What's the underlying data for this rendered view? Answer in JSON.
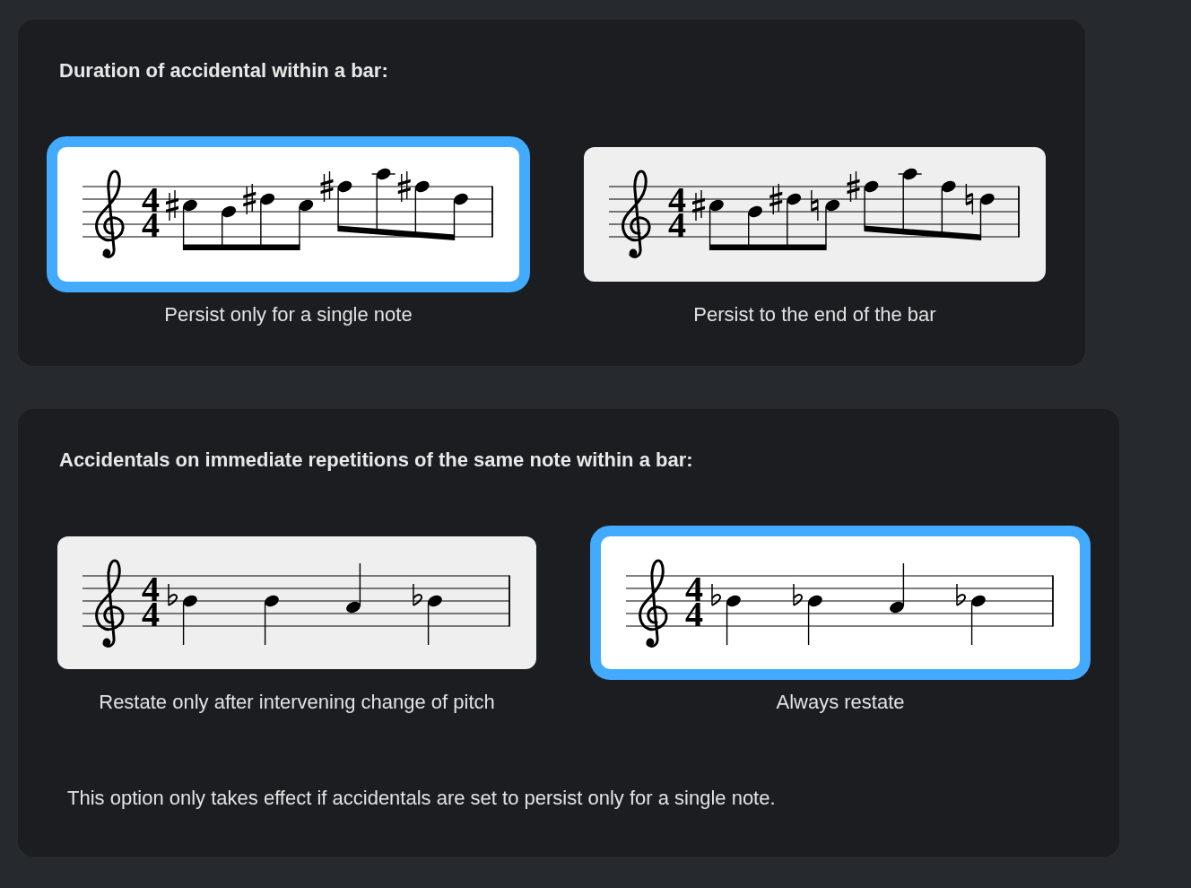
{
  "sections": [
    {
      "title": "Duration of accidental within a bar:",
      "options": [
        {
          "label": "Persist only for a single note",
          "selected": true,
          "score": {
            "time_signature": {
              "upper": "4",
              "lower": "4"
            },
            "notes": [
              {
                "kind": "sharp"
              },
              {
                "kind": "plain"
              },
              {
                "kind": "sharp"
              },
              {
                "kind": "plain"
              },
              {
                "kind": "sharp"
              },
              {
                "kind": "plain"
              },
              {
                "kind": "sharp"
              },
              {
                "kind": "plain"
              }
            ]
          }
        },
        {
          "label": "Persist to the end of the bar",
          "selected": false,
          "score": {
            "time_signature": {
              "upper": "4",
              "lower": "4"
            },
            "notes": [
              {
                "kind": "sharp"
              },
              {
                "kind": "plain"
              },
              {
                "kind": "sharp"
              },
              {
                "kind": "natural"
              },
              {
                "kind": "sharp"
              },
              {
                "kind": "plain"
              },
              {
                "kind": "plain"
              },
              {
                "kind": "natural"
              }
            ]
          }
        }
      ]
    },
    {
      "title": "Accidentals on immediate repetitions of the same note within a bar:",
      "options": [
        {
          "label": "Restate only after intervening change of pitch",
          "selected": false,
          "score": {
            "time_signature": {
              "upper": "4",
              "lower": "4"
            },
            "notes": [
              {
                "kind": "flat"
              },
              {
                "kind": "plain"
              },
              {
                "kind": "plain"
              },
              {
                "kind": "flat"
              }
            ]
          }
        },
        {
          "label": "Always restate",
          "selected": true,
          "score": {
            "time_signature": {
              "upper": "4",
              "lower": "4"
            },
            "notes": [
              {
                "kind": "flat"
              },
              {
                "kind": "flat"
              },
              {
                "kind": "plain"
              },
              {
                "kind": "flat"
              }
            ]
          }
        }
      ],
      "note": "This option only takes effect if accidentals are set to persist only for a single note."
    }
  ]
}
